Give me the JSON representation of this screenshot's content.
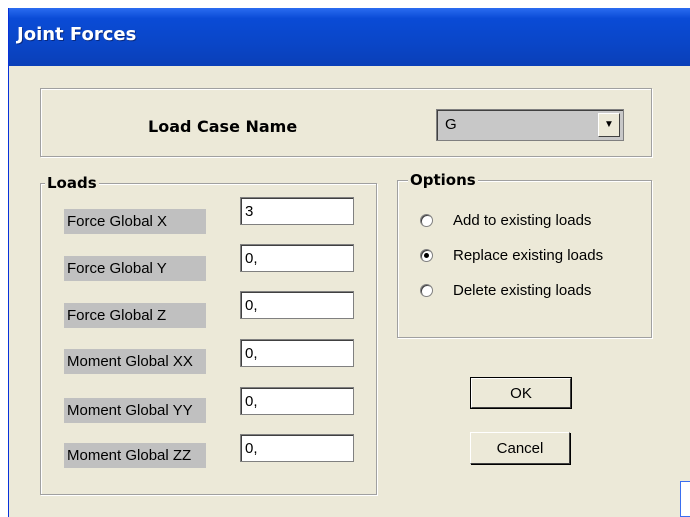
{
  "window": {
    "title": "Joint Forces"
  },
  "load_case": {
    "label": "Load Case Name",
    "value": "G"
  },
  "loads": {
    "title": "Loads",
    "fields": [
      {
        "label": "Force Global X",
        "value": "3"
      },
      {
        "label": "Force Global Y",
        "value": "0,"
      },
      {
        "label": "Force Global Z",
        "value": "0,"
      },
      {
        "label": "Moment Global XX",
        "value": "0,"
      },
      {
        "label": "Moment Global YY",
        "value": "0,"
      },
      {
        "label": "Moment Global ZZ",
        "value": "0,"
      }
    ]
  },
  "options": {
    "title": "Options",
    "items": [
      {
        "label": "Add to existing loads",
        "selected": false
      },
      {
        "label": "Replace existing loads",
        "selected": true
      },
      {
        "label": "Delete existing loads",
        "selected": false
      }
    ]
  },
  "buttons": {
    "ok": "OK",
    "cancel": "Cancel"
  },
  "icons": {
    "combo_arrow": "chevron-down-icon"
  }
}
